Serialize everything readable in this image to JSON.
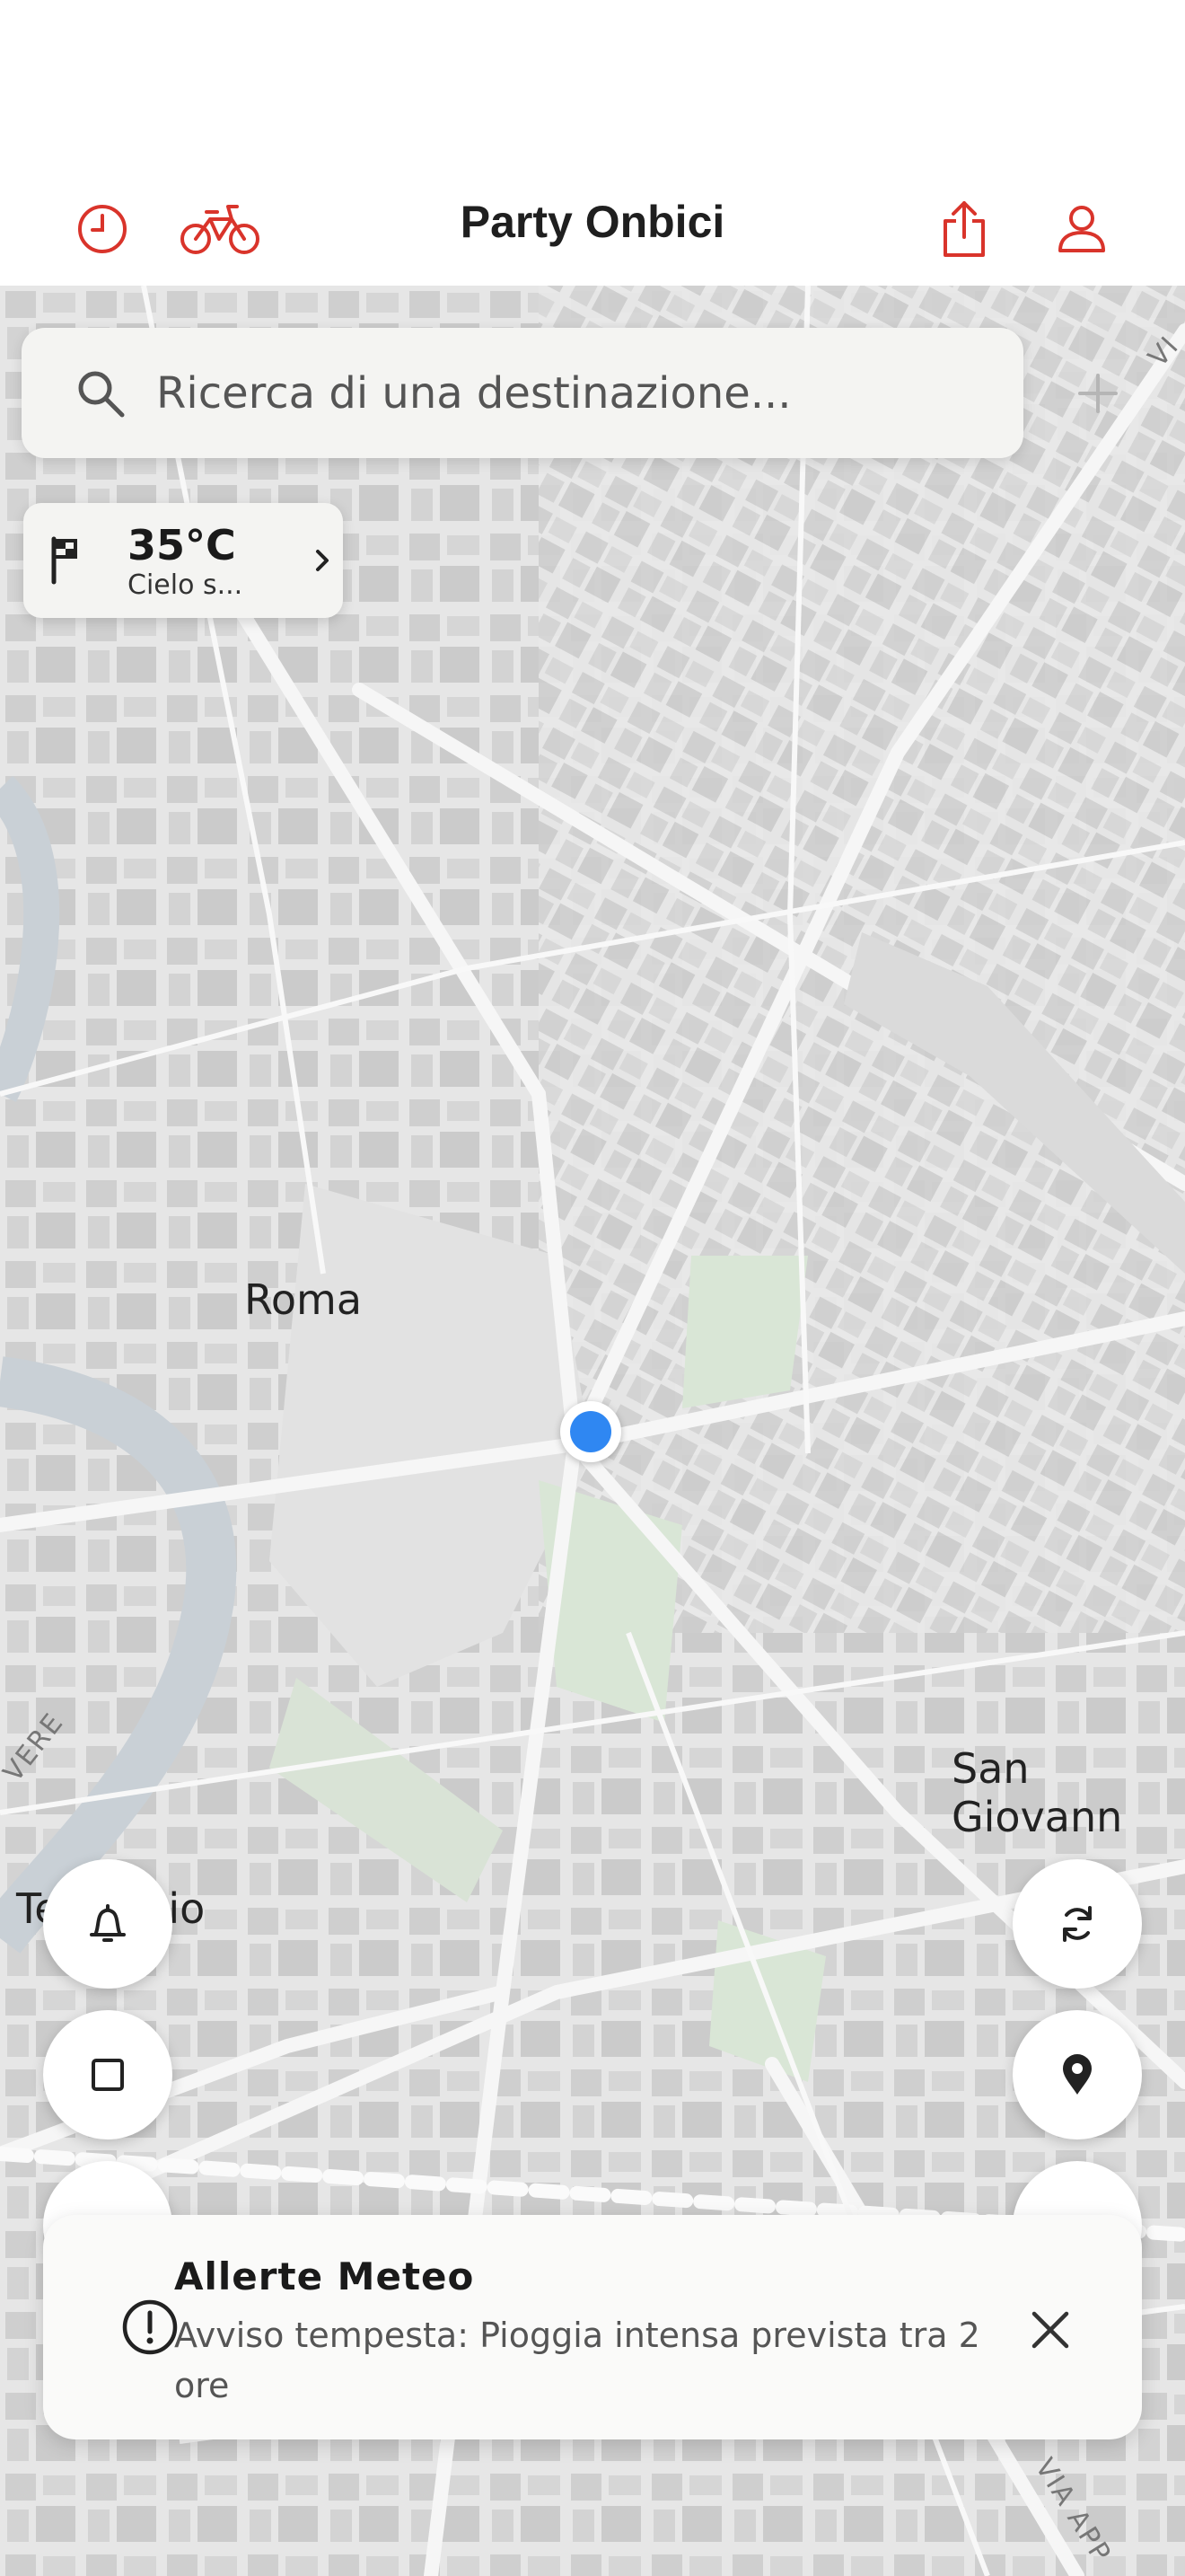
{
  "header": {
    "title": "Party Onbici",
    "icons": [
      "history-clock-icon",
      "bike-icon",
      "share-icon",
      "profile-icon"
    ],
    "accent_color": "#d9342b"
  },
  "search": {
    "placeholder": "Ricerca di una destinazione..."
  },
  "weather": {
    "temperature": "35°C",
    "condition": "Cielo s..."
  },
  "map": {
    "labels": {
      "roma": "Roma",
      "san_giovanni": "San Giovann",
      "testaccio": "Testaccio",
      "vere": "VERE",
      "via_ap": "VIA APP",
      "vi": "VI"
    },
    "user_location_color": "#2f87f2"
  },
  "fabs": {
    "left": [
      "bell-icon",
      "stop-square-icon"
    ],
    "right": [
      "refresh-icon",
      "location-pin-icon"
    ]
  },
  "alert": {
    "title": "Allerte Meteo",
    "message": "Avviso tempesta: Pioggia intensa prevista tra 2 ore"
  }
}
